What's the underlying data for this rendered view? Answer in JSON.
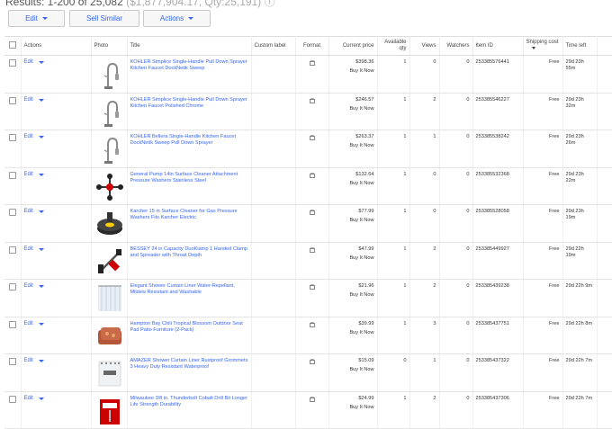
{
  "header": {
    "results_text": "Results: 1-200 of 25,082",
    "results_extra": "($1,877,904.17, Qty:25,191)"
  },
  "toolbar": {
    "edit_label": "Edit",
    "sell_similar_label": "Sell Similar",
    "actions_label": "Actions"
  },
  "table": {
    "columns": {
      "actions": "Actions",
      "photo": "Photo",
      "title": "Title",
      "custom_label": "Custom label",
      "format": "Format",
      "current_price": "Current price",
      "available_qty": "Available qty",
      "views": "Views",
      "watchers": "Watchers",
      "item_id": "Item ID",
      "shipping_cost": "Shipping cost",
      "time_left": "Time left"
    },
    "row_edit_label": "Edit",
    "rows": [
      {
        "title": "KOHLER Simplice Single-Handle Pull Down Sprayer Kitchen Faucet DockNetik Sweep",
        "price": "$398.36",
        "price_type": "Buy It Now",
        "qty": "1",
        "views": "0",
        "watchers": "0",
        "item_id": "253385576441",
        "shipping": "Free",
        "time_left": "29d 23h 55m",
        "photo": "faucet"
      },
      {
        "title": "KOHLER Simplice Single-Handle Pull Down Sprayer Kitchen Faucet Polished Chrome",
        "price": "$246.57",
        "price_type": "Buy It Now",
        "qty": "1",
        "views": "2",
        "watchers": "0",
        "item_id": "253385546227",
        "shipping": "Free",
        "time_left": "29d 23h 32m",
        "photo": "faucet"
      },
      {
        "title": "KOHLER Bellera Single-Handle Kitchen Faucet DockNetik Sweep Pull Down Sprayer",
        "price": "$263.37",
        "price_type": "Buy It Now",
        "qty": "1",
        "views": "1",
        "watchers": "0",
        "item_id": "253385538242",
        "shipping": "Free",
        "time_left": "29d 23h 26m",
        "photo": "faucet"
      },
      {
        "title": "General Pump 14in Surface Cleaner Attachment Pressure Washers Stainless Steel",
        "price": "$132.64",
        "price_type": "Buy It Now",
        "qty": "1",
        "views": "0",
        "watchers": "0",
        "item_id": "253385532368",
        "shipping": "Free",
        "time_left": "29d 23h 22m",
        "photo": "wheel"
      },
      {
        "title": "Karcher 15 in Surface Cleaner for Gas Pressure Washers Fits Karcher Electric",
        "price": "$77.99",
        "price_type": "Buy It Now",
        "qty": "1",
        "views": "0",
        "watchers": "0",
        "item_id": "253385528058",
        "shipping": "Free",
        "time_left": "29d 23h 19m",
        "photo": "disc"
      },
      {
        "title": "BESSEY 24 in Capacity DuoKlamp 1 Handed Clamp and Spreader with Throat Depth",
        "price": "$47.99",
        "price_type": "Buy It Now",
        "qty": "1",
        "views": "2",
        "watchers": "0",
        "item_id": "253385449927",
        "shipping": "Free",
        "time_left": "29d 22h 19m",
        "photo": "clamp"
      },
      {
        "title": "Elegant Shower Curtain Liner Water-Repellant, Mildew Resistant and Washable",
        "price": "$21.96",
        "price_type": "Buy It Now",
        "qty": "1",
        "views": "2",
        "watchers": "0",
        "item_id": "253385439238",
        "shipping": "Free",
        "time_left": "29d 22h 9m",
        "photo": "curtain"
      },
      {
        "title": "Hampton Bay Chili Tropical Blossom Outdoor Seat Pad Patio Furniture (2-Pack)",
        "price": "$39.99",
        "price_type": "Buy It Now",
        "qty": "1",
        "views": "3",
        "watchers": "0",
        "item_id": "253385437751",
        "shipping": "Free",
        "time_left": "29d 22h 8m",
        "photo": "cushion"
      },
      {
        "title": "AMAZER Shower Curtain Liner Rustproof Grommets 3 Heavy Duty Resistant Waterproof",
        "price": "$15.09",
        "price_type": "Buy It Now",
        "qty": "0",
        "views": "1",
        "watchers": "0",
        "item_id": "253385437322",
        "shipping": "Free",
        "time_left": "29d 22h 7m",
        "photo": "liner"
      },
      {
        "title": "Milwaukee 3/8 in. Thunderbolt Cobalt Drill Bit Longer Life Strength Durability",
        "price": "$24.99",
        "price_type": "Buy It Now",
        "qty": "1",
        "views": "2",
        "watchers": "0",
        "item_id": "253385437306",
        "shipping": "Free",
        "time_left": "29d 22h 7m",
        "photo": "drill"
      }
    ]
  },
  "colors": {
    "link": "#3665f3",
    "border": "#dddddd"
  }
}
